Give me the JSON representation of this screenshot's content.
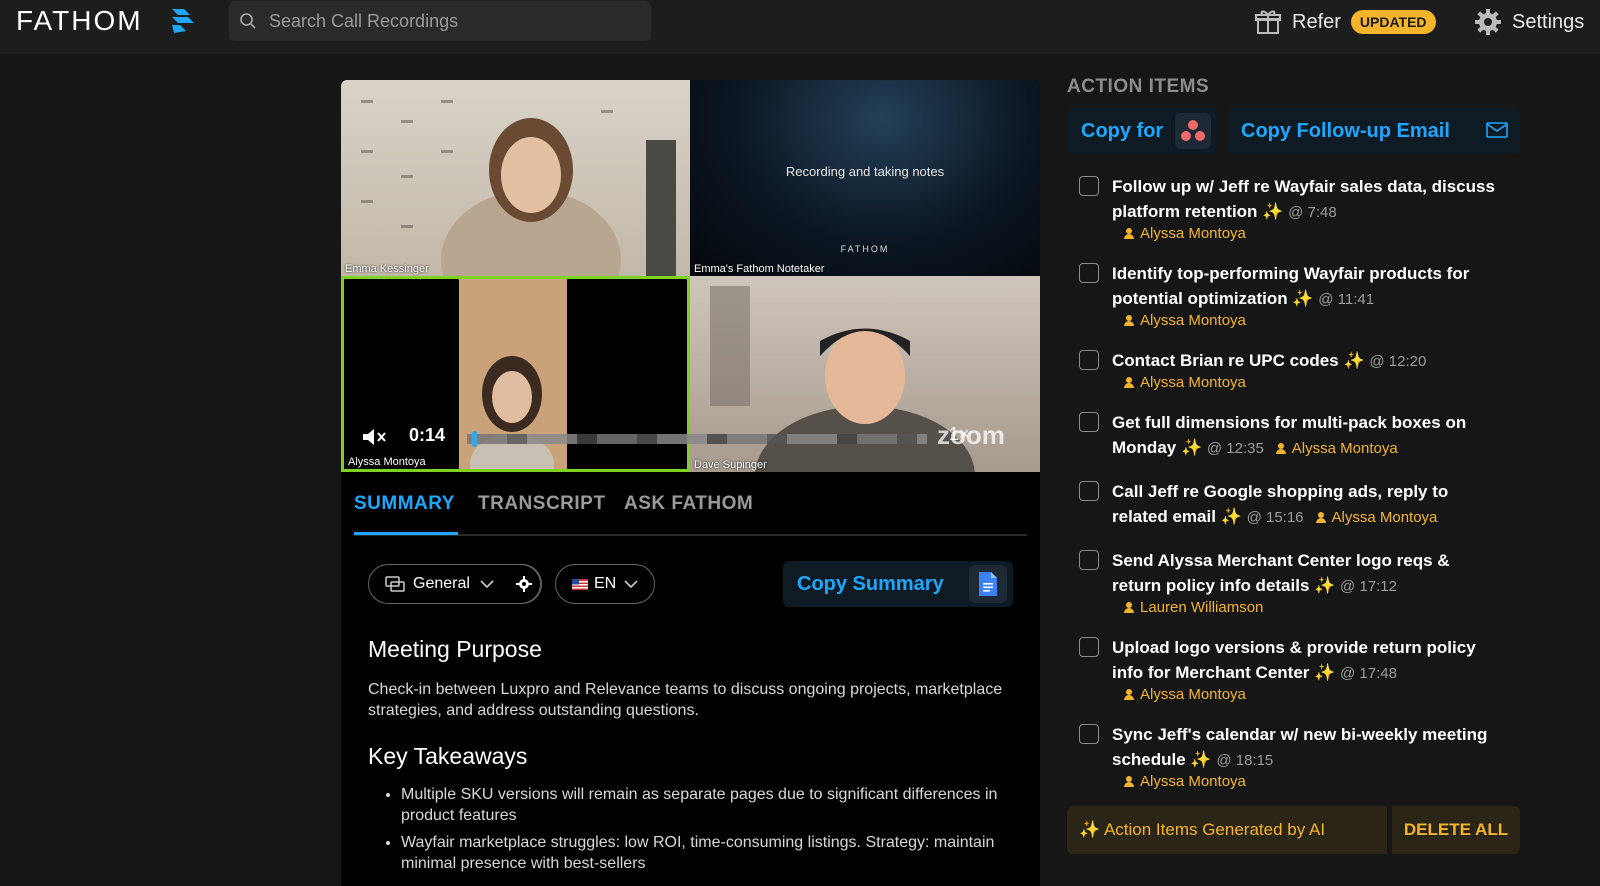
{
  "header": {
    "logo_text": "FATHOM",
    "search_placeholder": "Search Call Recordings",
    "refer_label": "Refer",
    "refer_badge": "UPDATED",
    "settings_label": "Settings"
  },
  "video": {
    "tiles": [
      {
        "name": "Emma Kessinger"
      },
      {
        "name": "Emma's Fathom Notetaker",
        "message": "Recording and taking notes",
        "brand": "FATHOM"
      },
      {
        "name": "Alyssa Montoya"
      },
      {
        "name": "Dave Supinger"
      }
    ],
    "time": "0:14",
    "speed": "1×",
    "zoom_mark": "zoom",
    "progress_fraction": 0.01
  },
  "tabs": [
    {
      "label": "SUMMARY",
      "active": true
    },
    {
      "label": "TRANSCRIPT",
      "active": false
    },
    {
      "label": "ASK FATHOM",
      "active": false
    }
  ],
  "summary_toolbar": {
    "template": "General",
    "language": "EN",
    "copy_summary": "Copy Summary"
  },
  "summary": {
    "purpose_heading": "Meeting Purpose",
    "purpose_text": "Check-in between Luxpro and Relevance teams to discuss ongoing projects, marketplace strategies, and address outstanding questions.",
    "takeaways_heading": "Key Takeaways",
    "takeaways": [
      "Multiple SKU versions will remain as separate pages due to significant differences in product features",
      "Wayfair marketplace struggles: low ROI, time-consuming listings. Strategy: maintain minimal presence with best-sellers"
    ]
  },
  "action_items": {
    "title": "ACTION ITEMS",
    "copy_for": "Copy for",
    "copy_email": "Copy Follow-up Email",
    "items": [
      {
        "text": "Follow up w/ Jeff re Wayfair sales data, discuss platform retention",
        "time": "@ 7:48",
        "assignee": "Alyssa Montoya",
        "inline": false
      },
      {
        "text": "Identify top-performing Wayfair products for potential optimization",
        "time": "@ 11:41",
        "assignee": "Alyssa Montoya",
        "inline": false
      },
      {
        "text": "Contact Brian re UPC codes",
        "time": "@ 12:20",
        "assignee": "Alyssa Montoya",
        "inline": false
      },
      {
        "text": "Get full dimensions for multi-pack boxes on Monday",
        "time": "@ 12:35",
        "assignee": "Alyssa Montoya",
        "inline": true
      },
      {
        "text": "Call Jeff re Google shopping ads, reply to related email",
        "time": "@ 15:16",
        "assignee": "Alyssa Montoya",
        "inline": true
      },
      {
        "text": "Send Alyssa Merchant Center logo reqs & return policy info details",
        "time": "@ 17:12",
        "assignee": "Lauren Williamson",
        "inline": false
      },
      {
        "text": "Upload logo versions & provide return policy info for Merchant Center",
        "time": "@ 17:48",
        "assignee": "Alyssa Montoya",
        "inline": false
      },
      {
        "text": "Sync Jeff's calendar w/ new bi-weekly meeting schedule",
        "time": "@ 18:15",
        "assignee": "Alyssa Montoya",
        "inline": false
      }
    ],
    "ai_note": "✨ Action Items Generated by AI",
    "delete_all": "DELETE ALL"
  },
  "colors": {
    "accent": "#1ea7fd",
    "assignee": "#f4b52a",
    "active_speaker": "#7ed321",
    "badge": "#f4b52a"
  }
}
